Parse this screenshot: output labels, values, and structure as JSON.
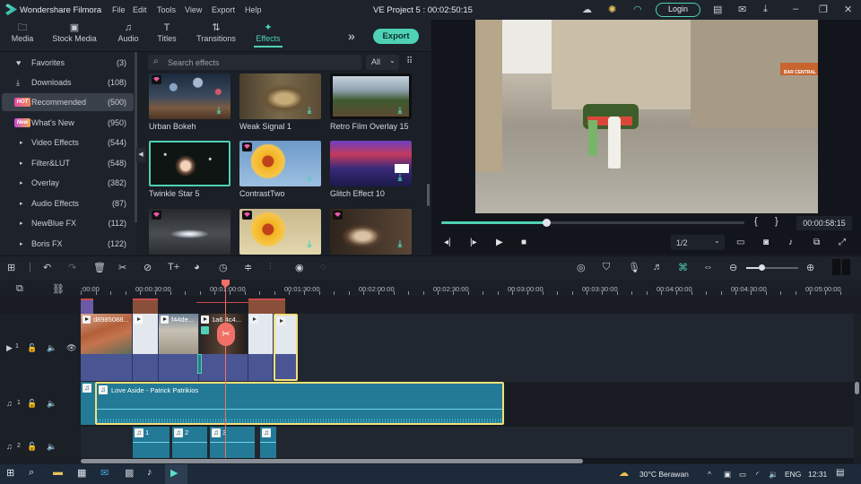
{
  "titlebar": {
    "app_name": "Wondershare Filmora",
    "menus": [
      "File",
      "Edit",
      "Tools",
      "View",
      "Export",
      "Help"
    ],
    "project_title": "VE Project 5 : 00:02:50:15",
    "login_label": "Login",
    "icons": [
      "cloud-icon",
      "bulb-icon",
      "headset-icon",
      "save-icon",
      "mail-icon",
      "download-icon",
      "minimize-icon",
      "restore-icon",
      "close-icon"
    ]
  },
  "media_tabs": [
    {
      "label": "Media",
      "icon": "🗀"
    },
    {
      "label": "Stock Media",
      "icon": "▣"
    },
    {
      "label": "Audio",
      "icon": "♫"
    },
    {
      "label": "Titles",
      "icon": "T"
    },
    {
      "label": "Transitions",
      "icon": "⇅"
    },
    {
      "label": "Effects",
      "icon": "✦",
      "active": true
    }
  ],
  "more_label": "»",
  "export_label": "Export",
  "categories": [
    {
      "label": "Favorites",
      "count": "(3)",
      "icon": "♥"
    },
    {
      "label": "Downloads",
      "count": "(108)",
      "icon": "⤓"
    },
    {
      "label": "Recommended",
      "count": "(500)",
      "badge": "HOT",
      "active": true
    },
    {
      "label": "What's New",
      "count": "(950)",
      "badge": "New"
    },
    {
      "label": "Video Effects",
      "count": "(544)",
      "icon": "▸"
    },
    {
      "label": "Filter&LUT",
      "count": "(548)",
      "icon": "▸"
    },
    {
      "label": "Overlay",
      "count": "(382)",
      "icon": "▸"
    },
    {
      "label": "Audio Effects",
      "count": "(87)",
      "icon": "▸"
    },
    {
      "label": "NewBlue FX",
      "count": "(112)",
      "icon": "▸"
    },
    {
      "label": "Boris FX",
      "count": "(122)",
      "icon": "▸"
    }
  ],
  "search": {
    "placeholder": "Search effects",
    "value": ""
  },
  "filter_value": "All",
  "effects": [
    {
      "name": "Urban Bokeh",
      "premium": true,
      "download": true
    },
    {
      "name": "Weak Signal 1",
      "premium": false,
      "download": true
    },
    {
      "name": "Retro Film Overlay 15",
      "premium": false,
      "download": true
    },
    {
      "name": "Twinkle Star 5",
      "premium": false,
      "download": false,
      "selected": true
    },
    {
      "name": "ContrastTwo",
      "premium": true,
      "download": true
    },
    {
      "name": "Glitch Effect 10",
      "premium": false,
      "download": true
    },
    {
      "name": "",
      "premium": true,
      "download": false
    },
    {
      "name": "",
      "premium": true,
      "download": true
    },
    {
      "name": "",
      "premium": true,
      "download": true
    }
  ],
  "preview": {
    "progress": 0.345,
    "timecode": "00:00:58:15",
    "mark_in": "{",
    "mark_out": "}",
    "quality": "1/2",
    "shop_sign": "BAR CENTRAL"
  },
  "timeline": {
    "ruler_labels": [
      ":00:00",
      "00:00:30:00",
      "00:01:00:00",
      "00:01:30:00",
      "00:02:00:00",
      "00:02:30:00",
      "00:03:00:00",
      "00:03:30:00",
      "00:04:00:00",
      "00:04:30:00",
      "00:05:00:00"
    ],
    "zoom_level": 0.3,
    "video_track": {
      "label": "1",
      "clips": [
        {
          "name": "d8985088..."
        },
        {
          "name": ""
        },
        {
          "name": "f44de..."
        },
        {
          "name": "1a6 4c4..."
        },
        {
          "name": ""
        },
        {
          "name": ""
        }
      ]
    },
    "audio_track_1": {
      "label": "1",
      "clip_name": "Love Aside - Patrick Patrikios"
    },
    "audio_track_2": {
      "label": "2",
      "clips": [
        "1",
        "2",
        "3",
        ""
      ]
    }
  },
  "taskbar": {
    "weather": "30°C  Berawan",
    "language": "ENG",
    "time": "12:31"
  }
}
